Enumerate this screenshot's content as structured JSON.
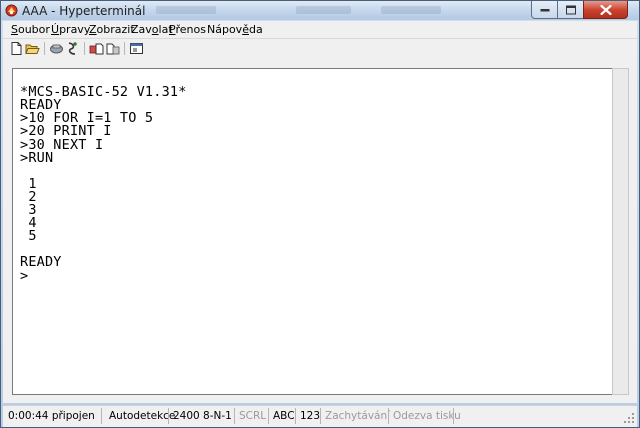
{
  "window": {
    "title": "AAA - Hyperterminál"
  },
  "menu": {
    "items": [
      {
        "label": "Soubor",
        "hotkey_index": 0
      },
      {
        "label": "Úpravy",
        "hotkey_index": 0
      },
      {
        "label": "Zobrazit",
        "hotkey_index": 0
      },
      {
        "label": "Zavolat",
        "hotkey_index": 3
      },
      {
        "label": "Přenos",
        "hotkey_index": 0
      },
      {
        "label": "Nápověda",
        "hotkey_index": 5
      }
    ]
  },
  "toolbar": {
    "buttons": [
      {
        "name": "new-file-icon"
      },
      {
        "name": "open-folder-icon"
      },
      {
        "name": "call-icon"
      },
      {
        "name": "disconnect-icon"
      },
      {
        "name": "send-icon"
      },
      {
        "name": "properties-icon"
      }
    ]
  },
  "terminal": {
    "lines": [
      "",
      "*MCS-BASIC-52 V1.31*",
      "READY",
      ">10 FOR I=1 TO 5",
      ">20 PRINT I",
      ">30 NEXT I",
      ">RUN",
      "",
      " 1",
      " 2",
      " 3",
      " 4",
      " 5",
      "",
      "READY",
      ">"
    ]
  },
  "status": {
    "time": "0:00:44 připojen",
    "detect": "Autodetekce",
    "params": "2400 8-N-1",
    "scrl": "SCRL",
    "caps": "ABC",
    "num": "123",
    "capture": "Zachytávání",
    "print": "Odezva tisku"
  },
  "colors": {
    "close_button": "#c9402c",
    "title_gradient": "#c4d7ec",
    "terminal_bg": "#ffffff"
  }
}
